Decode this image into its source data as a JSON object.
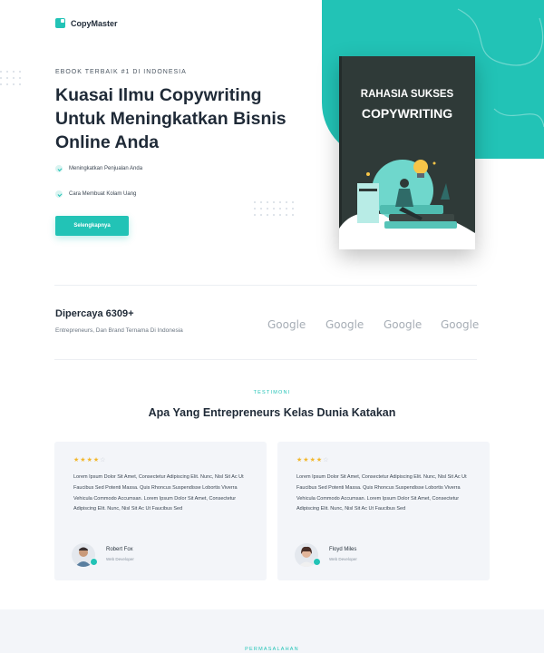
{
  "brand": {
    "name": "CopyMaster"
  },
  "hero": {
    "eyebrow": "EBOOK TERBAIK #1 DI INDONESIA",
    "headline": "Kuasai Ilmu Copywriting Untuk Meningkatkan Bisnis Online Anda",
    "features": [
      "Meningkatkan Penjualan Anda",
      "Cara Membuat Kolam Uang"
    ],
    "cta_label": "Selengkapnya"
  },
  "book": {
    "title_line1": "RAHASIA SUKSES",
    "title_line2": "COPYWRITING"
  },
  "trust": {
    "title": "Dipercaya 6309+",
    "subtitle": "Entrepreneurs, Dan Brand Ternama Di Indonesia",
    "brands": [
      "Google",
      "Google",
      "Google",
      "Google"
    ]
  },
  "testimonials": {
    "label": "TESTIMONI",
    "title": "Apa Yang Entrepreneurs Kelas Dunia Katakan",
    "items": [
      {
        "rating": 4,
        "text": "Lorem Ipsum Dolor Sit Amet, Consectetur Adipiscing Elit. Nunc, Nisl Sit Ac Ut Faucibus Sed Potenti Massa. Quis Rhoncus Suspendisse Lobortis Viverra Vehicula Commodo Accumsan. Lorem Ipsum Dolor Sit Amet, Consectetur Adipiscing Elit. Nunc, Nisl Sit Ac Ut Faucibus Sed",
        "name": "Robert Fox",
        "role": "Web Developer"
      },
      {
        "rating": 4,
        "text": "Lorem Ipsum Dolor Sit Amet, Consectetur Adipiscing Elit. Nunc, Nisl Sit Ac Ut Faucibus Sed Potenti Massa. Quis Rhoncus Suspendisse Lobortis Viverra Vehicula Commodo Accumsan. Lorem Ipsum Dolor Sit Amet, Consectetur Adipiscing Elit. Nunc, Nisl Sit Ac Ut Faucibus Sed",
        "name": "Floyd Miles",
        "role": "Web Developer"
      }
    ]
  },
  "next_section": {
    "label": "PERMASALAHAN"
  },
  "colors": {
    "accent": "#22c3b6",
    "dark": "#1f2a37",
    "book": "#2f3a38",
    "star": "#f2b72b"
  },
  "icons": {
    "logo": "copymaster-logo-icon",
    "feature": "check-icon",
    "rating": "star-icon"
  }
}
